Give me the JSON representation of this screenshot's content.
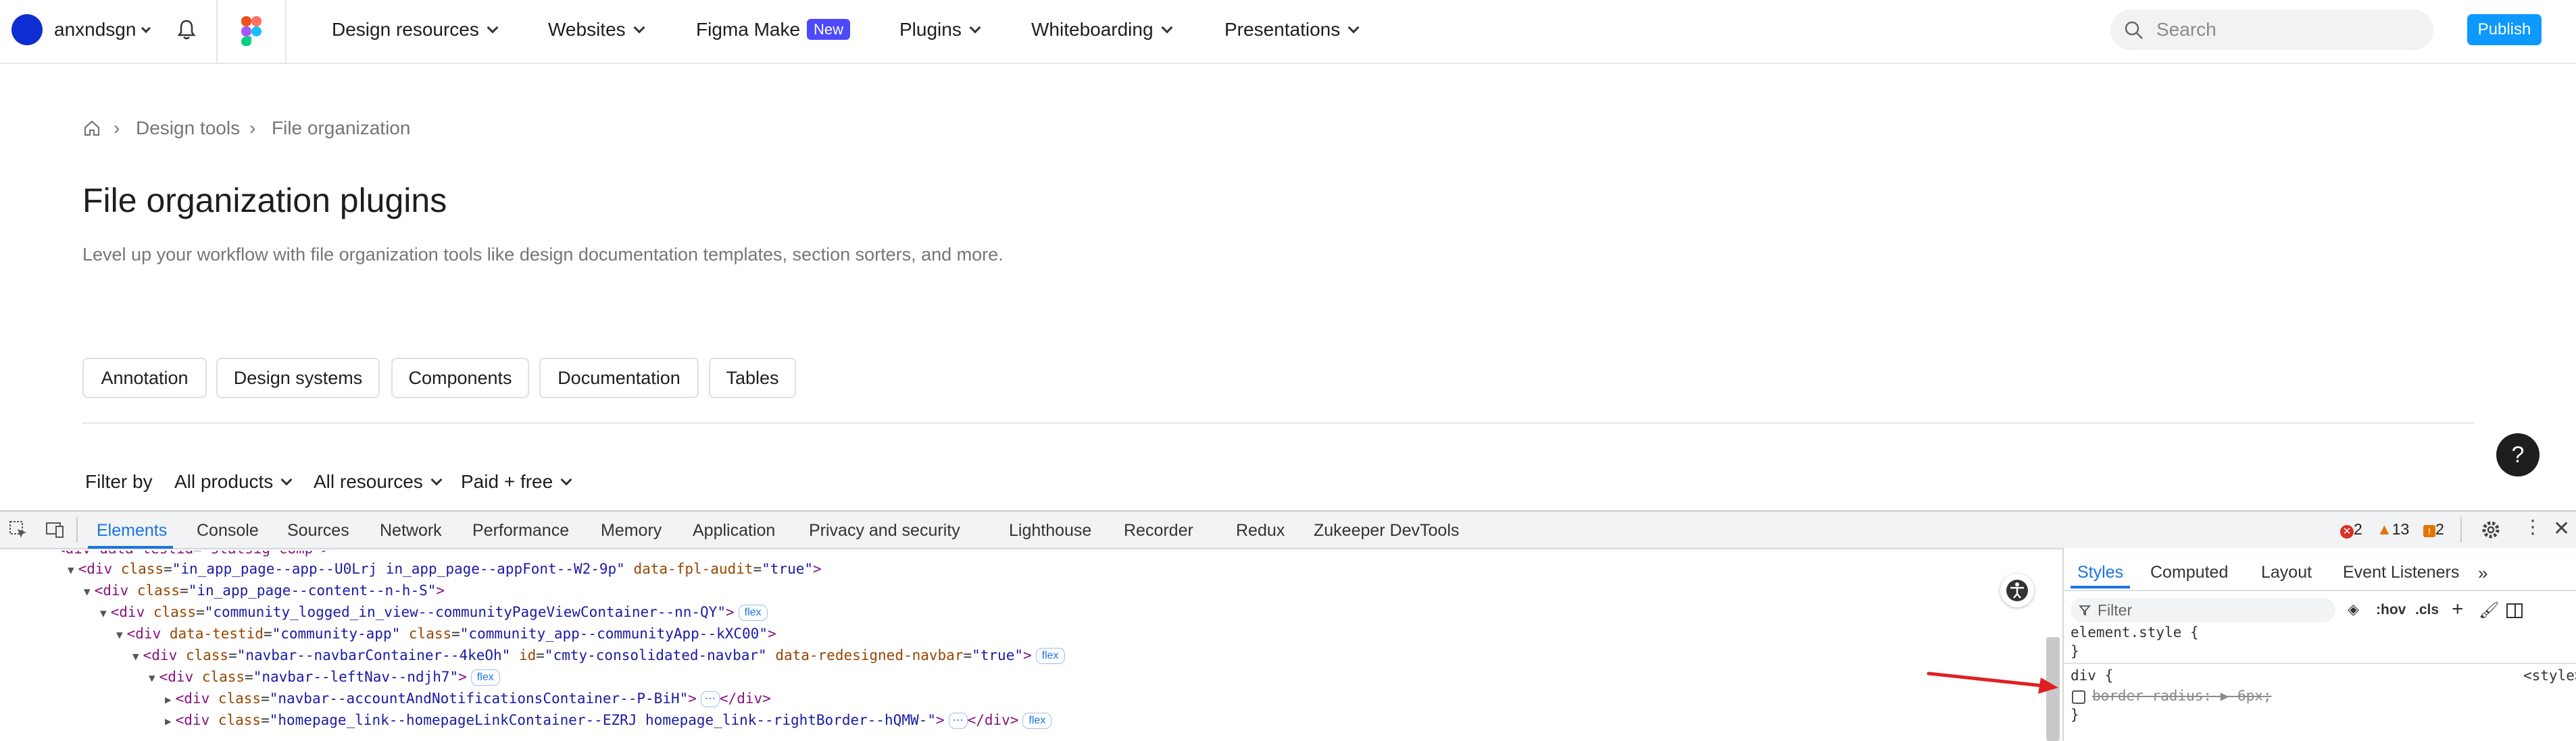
{
  "topnav": {
    "username": "anxndsgn",
    "items": [
      {
        "label": "Design resources"
      },
      {
        "label": "Websites"
      },
      {
        "label": "Figma Make",
        "badge": "New"
      },
      {
        "label": "Plugins"
      },
      {
        "label": "Whiteboarding"
      },
      {
        "label": "Presentations"
      }
    ],
    "search_placeholder": "Search",
    "publish_label": "Publish"
  },
  "breadcrumb": [
    "Design tools",
    "File organization"
  ],
  "page": {
    "title": "File organization plugins",
    "subtitle": "Level up your workflow with file organization tools like design documentation templates, section sorters, and more."
  },
  "chips": [
    "Annotation",
    "Design systems",
    "Components",
    "Documentation",
    "Tables"
  ],
  "filters": {
    "label": "Filter by",
    "options": [
      "All products",
      "All resources",
      "Paid + free"
    ]
  },
  "help_label": "?",
  "devtools": {
    "tabs": [
      "Elements",
      "Console",
      "Sources",
      "Network",
      "Performance",
      "Memory",
      "Application",
      "Privacy and security",
      "Lighthouse",
      "Recorder",
      "Redux",
      "Zukeeper DevTools"
    ],
    "errors": "2",
    "warnings": "13",
    "issues": "2",
    "flex_badge": "flex",
    "dom": {
      "top_partial": "<div data-testid=\"statsig-comp\">",
      "l1_open": "<div ",
      "l1_a1": "class",
      "l1_v1": "\"in_app_page--app--U0Lrj in_app_page--appFont--W2-9p\"",
      "l1_a2": "data-fpl-audit",
      "l1_v2": "\"true\"",
      "l1_close": ">",
      "l2_open": "<div ",
      "l2_a1": "class",
      "l2_v1": "\"in_app_page--content--n-h-S\"",
      "l2_close": ">",
      "l3_open": "<div ",
      "l3_a1": "class",
      "l3_v1": "\"community_logged_in_view--communityPageViewContainer--nn-QY\"",
      "l3_close": ">",
      "l4_open": "<div ",
      "l4_a1": "data-testid",
      "l4_v1": "\"community-app\"",
      "l4_a2": "class",
      "l4_v2": "\"community_app--communityApp--kXC00\"",
      "l4_close": ">",
      "l5_open": "<div ",
      "l5_a1": "class",
      "l5_v1": "\"navbar--navbarContainer--4keOh\"",
      "l5_a2": "id",
      "l5_v2": "\"cmty-consolidated-navbar\"",
      "l5_a3": "data-redesigned-navbar",
      "l5_v3": "\"true\"",
      "l5_close": ">",
      "l6_open": "<div ",
      "l6_a1": "class",
      "l6_v1": "\"navbar--leftNav--ndjh7\"",
      "l6_close": ">",
      "l7_open": "<div ",
      "l7_a1": "class",
      "l7_v1": "\"navbar--accountAndNotificationsContainer--P-BiH\"",
      "l7_close": ">",
      "l7_end": "</div>",
      "l8_open": "<div ",
      "l8_a1": "class",
      "l8_v1": "\"homepage_link--homepageLinkContainer--EZRJ homepage_link--rightBorder--hQMW-\"",
      "l8_close": ">",
      "l8_end": "</div>"
    },
    "styles": {
      "tabs": [
        "Styles",
        "Computed",
        "Layout",
        "Event Listeners"
      ],
      "filter_placeholder": "Filter",
      "hov": ":hov",
      "cls": ".cls",
      "element_style": "element.style {",
      "close_brace": "}",
      "rule_selector": "div {",
      "rule_source": "<style>",
      "prop_name": "border-radius",
      "prop_value": "6px;"
    }
  }
}
